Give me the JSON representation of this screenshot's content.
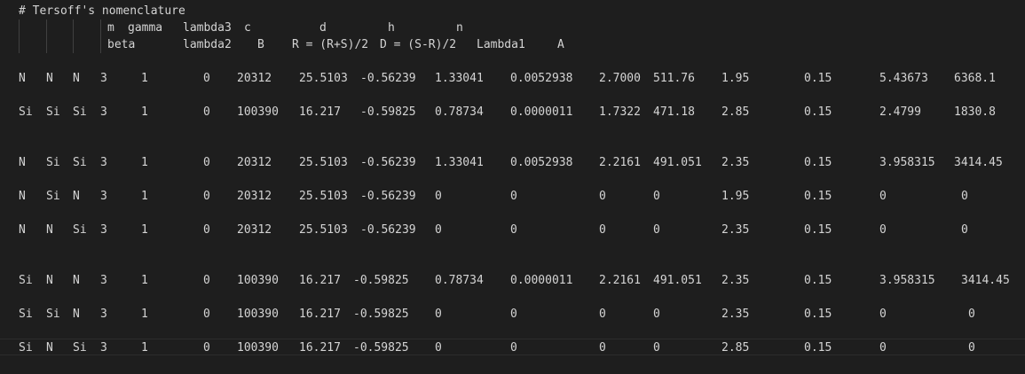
{
  "comment": "# Tersoff's nomenclature",
  "header1": {
    "m": "m",
    "gamma": "gamma",
    "lambda3": "lambda3",
    "c": "c",
    "d": "d",
    "h": "h",
    "n": "n"
  },
  "header2": {
    "beta": "beta",
    "lambda2": "lambda2",
    "B": "B",
    "R": "R = (R+S)/2",
    "D": "D = (S-R)/2",
    "Lambda1": "Lambda1",
    "A": "A"
  },
  "rows": [
    [
      "N",
      "N",
      "N",
      "3",
      "1",
      "0",
      "20312",
      "25.5103",
      "-0.56239",
      "1.33041",
      "0.0052938",
      "2.7000",
      "511.76",
      "1.95",
      "0.15",
      "5.43673",
      "6368.1"
    ],
    [
      "Si",
      "Si",
      "Si",
      "3",
      "1",
      "0",
      "100390",
      "16.217",
      "-0.59825",
      "0.78734",
      "0.0000011",
      "1.7322",
      "471.18",
      "2.85",
      "0.15",
      "2.4799",
      "1830.8"
    ],
    [
      "N",
      "Si",
      "Si",
      "3",
      "1",
      "0",
      "20312",
      "25.5103",
      "-0.56239",
      "1.33041",
      "0.0052938",
      "2.2161",
      "491.051",
      "2.35",
      "0.15",
      "3.958315",
      "3414.45"
    ],
    [
      "N",
      "Si",
      "N",
      "3",
      "1",
      "0",
      "20312",
      "25.5103",
      "-0.56239",
      "0",
      "0",
      "0",
      "0",
      "1.95",
      "0.15",
      "0",
      "0"
    ],
    [
      "N",
      "N",
      "Si",
      "3",
      "1",
      "0",
      "20312",
      "25.5103",
      "-0.56239",
      "0",
      "0",
      "0",
      "0",
      "2.35",
      "0.15",
      "0",
      "0"
    ],
    [
      "Si",
      "N",
      "N",
      "3",
      "1",
      "0",
      "100390",
      "16.217",
      "-0.59825",
      "0.78734",
      "0.0000011",
      "2.2161",
      "491.051",
      "2.35",
      "0.15",
      "3.958315",
      "3414.45"
    ],
    [
      "Si",
      "Si",
      "N",
      "3",
      "1",
      "0",
      "100390",
      "16.217",
      "-0.59825",
      "0",
      "0",
      "0",
      "0",
      "2.35",
      "0.15",
      "0",
      "0"
    ],
    [
      "Si",
      "N",
      "Si",
      "3",
      "1",
      "0",
      "100390",
      "16.217",
      "-0.59825",
      "0",
      "0",
      "0",
      "0",
      "2.85",
      "0.15",
      "0",
      "0"
    ]
  ]
}
